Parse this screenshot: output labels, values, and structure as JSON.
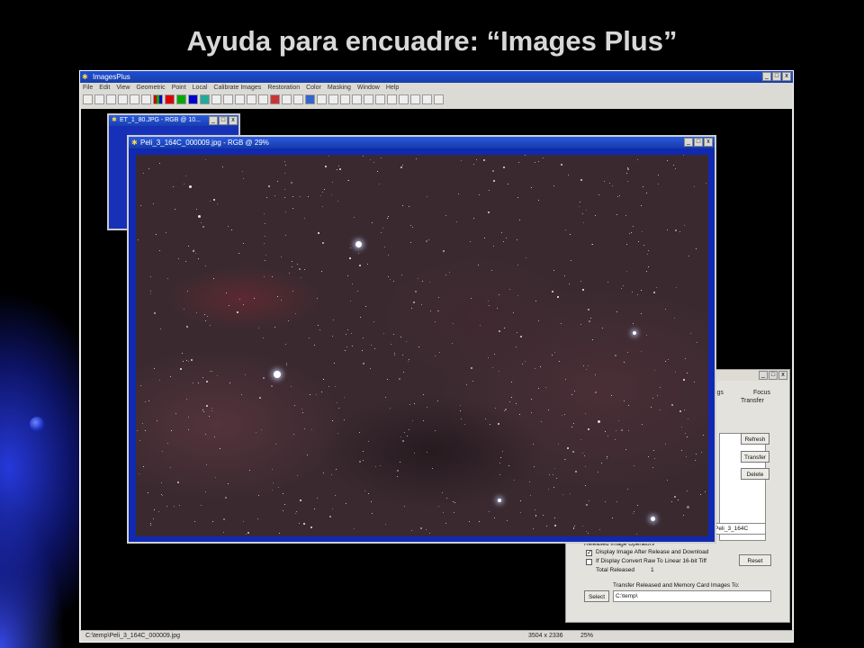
{
  "slide": {
    "title": "Ayuda para encuadre: “Images Plus”"
  },
  "app": {
    "title": "ImagesPlus",
    "menu": [
      "File",
      "Edit",
      "View",
      "Geometric",
      "Point",
      "Local",
      "Calibrate Images",
      "Restoration",
      "Color",
      "Masking",
      "Window",
      "Help"
    ],
    "status_path": "C:\\temp\\Peli_3_164C_000009.jpg",
    "status_size": "3504 x 2336",
    "status_zoom": "25%"
  },
  "child_back": {
    "title": "ET_1_80.JPG - RGB @ 10..."
  },
  "image_window": {
    "title": "Peli_3_164C_000009.jpg - RGB @ 29%"
  },
  "panel": {
    "tabs": [
      "ings",
      "Focus",
      "Transfer"
    ],
    "buttons": {
      "refresh": "Refresh",
      "transfer": "Transfer",
      "delete": "Delete",
      "reset": "Reset",
      "select": "Select"
    },
    "filename_field": "Peli_3_164C",
    "operators_heading": "Released Image Operators",
    "chk_display": "Display Image After Release and Download",
    "chk_convert": "If Display Convert Raw To Linear 16-bit Tiff",
    "total_released_label": "Total Released",
    "total_released_value": "1",
    "transfer_to_label": "Transfer Released and Memory Card Images To:",
    "path_field": "C:\\temp\\"
  },
  "window_buttons": {
    "min": "_",
    "max": "□",
    "close": "x"
  }
}
